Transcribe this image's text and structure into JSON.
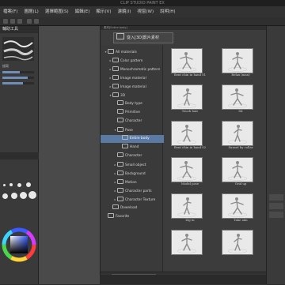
{
  "app": {
    "title": "CLIP STUDIO PAINT EX"
  },
  "menu": [
    "檔案(F)",
    "圖層(L)",
    "選擇範圍(S)",
    "編輯(E)",
    "顯示(V)",
    "濾鏡(I)",
    "視窗(W)",
    "說明(H)"
  ],
  "left_panel": {
    "tab_label": "輔助工具",
    "sublabel": "描寫"
  },
  "dialog": {
    "title": "素材[Entire body]",
    "import_button": "從入[3D]影片素材",
    "search_placeholder": "請輸入關鍵字"
  },
  "tree": [
    {
      "label": "All materials",
      "arrow": "▾",
      "level": 0,
      "selected": false
    },
    {
      "label": "Color pattern",
      "arrow": "▸",
      "level": 1,
      "selected": false
    },
    {
      "label": "Monochromatic pattern",
      "arrow": "▸",
      "level": 1,
      "selected": false
    },
    {
      "label": "Image material",
      "arrow": "▸",
      "level": 1,
      "selected": false
    },
    {
      "label": "Image material",
      "arrow": "▸",
      "level": 1,
      "selected": false
    },
    {
      "label": "3D",
      "arrow": "▾",
      "level": 1,
      "selected": false
    },
    {
      "label": "Body type",
      "arrow": "",
      "level": 2,
      "selected": false
    },
    {
      "label": "Primitive",
      "arrow": "",
      "level": 2,
      "selected": false
    },
    {
      "label": "Character",
      "arrow": "",
      "level": 2,
      "selected": false
    },
    {
      "label": "Pose",
      "arrow": "▾",
      "level": 2,
      "selected": false
    },
    {
      "label": "Entire body",
      "arrow": "",
      "level": 3,
      "selected": true
    },
    {
      "label": "Hand",
      "arrow": "",
      "level": 3,
      "selected": false
    },
    {
      "label": "Character",
      "arrow": "",
      "level": 2,
      "selected": false
    },
    {
      "label": "Small object",
      "arrow": "▸",
      "level": 2,
      "selected": false
    },
    {
      "label": "Background",
      "arrow": "▸",
      "level": 2,
      "selected": false
    },
    {
      "label": "Motion",
      "arrow": "▸",
      "level": 2,
      "selected": false
    },
    {
      "label": "Character parts",
      "arrow": "▸",
      "level": 2,
      "selected": false
    },
    {
      "label": "Character Texture",
      "arrow": "▸",
      "level": 2,
      "selected": false
    },
    {
      "label": "Download",
      "arrow": "",
      "level": 1,
      "selected": false
    },
    {
      "label": "Favorite",
      "arrow": "",
      "level": 0,
      "selected": false
    }
  ],
  "materials": [
    {
      "label": "Bent chin in hand 01"
    },
    {
      "label": "Relax (man)"
    },
    {
      "label": "Touch hair"
    },
    {
      "label": "Sit"
    },
    {
      "label": "Bent chin in hand 02"
    },
    {
      "label": "Sunset by collar"
    },
    {
      "label": "Model pose"
    },
    {
      "label": "Grid up"
    },
    {
      "label": "Zig in"
    },
    {
      "label": "Take aim"
    },
    {
      "label": ""
    },
    {
      "label": ""
    }
  ]
}
